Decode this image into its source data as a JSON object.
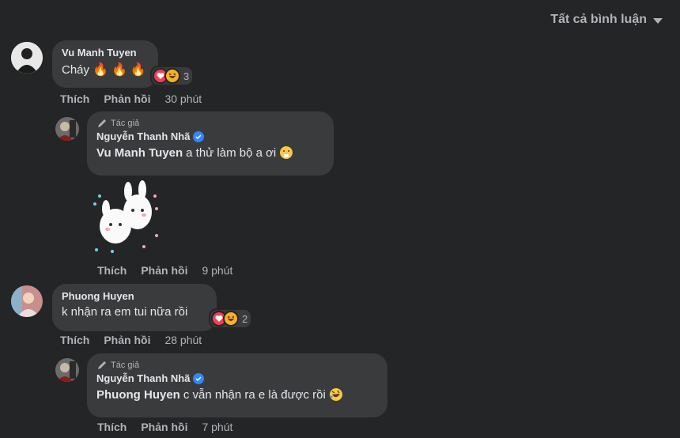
{
  "sort": {
    "label": "Tất cả bình luận"
  },
  "comments": [
    {
      "author": "Vu Manh Tuyen",
      "text": "Cháy",
      "reaction_count": "3",
      "actions": {
        "like": "Thích",
        "reply": "Phản hồi",
        "time": "30 phút"
      },
      "reply": {
        "author_tag": "Tác giả",
        "author": "Nguyễn Thanh Nhã",
        "mention": "Vu Manh Tuyen",
        "text": "a thử làm bộ a ơi",
        "actions": {
          "like": "Thích",
          "reply": "Phản hồi",
          "time": "9 phút"
        }
      }
    },
    {
      "author": "Phuong Huyen",
      "text": "k nhận ra em tui nữa rồi",
      "reaction_count": "2",
      "actions": {
        "like": "Thích",
        "reply": "Phản hồi",
        "time": "28 phút"
      },
      "reply": {
        "author_tag": "Tác giả",
        "author": "Nguyễn Thanh Nhã",
        "mention": "Phuong Huyen",
        "text": "c vẫn nhận ra e là được rồi",
        "actions": {
          "like": "Thích",
          "reply": "Phản hồi",
          "time": "7 phút"
        }
      }
    }
  ],
  "colors": {
    "background": "#242526",
    "bubble": "#3a3b3c",
    "verified": "#2d88ff",
    "love": "#f33e58",
    "haha": "#f7b125"
  }
}
